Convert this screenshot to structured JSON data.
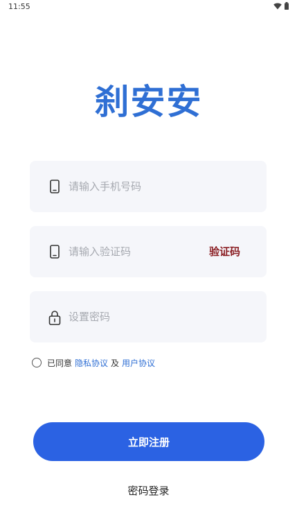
{
  "status_bar": {
    "time": "11:55"
  },
  "logo": {
    "text": "刹安安",
    "color": "#2f6fd4"
  },
  "form": {
    "phone": {
      "placeholder": "请输入手机号码",
      "value": "",
      "icon": "phone-icon"
    },
    "code": {
      "placeholder": "请输入验证码",
      "value": "",
      "icon": "phone-icon",
      "get_code_label": "验证码"
    },
    "password": {
      "placeholder": "设置密码",
      "value": "",
      "icon": "lock-icon"
    }
  },
  "agreement": {
    "prefix": "已同意",
    "privacy_link": "隐私协议",
    "conjunction": "及",
    "user_link": "用户协议",
    "checked": false
  },
  "actions": {
    "register_label": "立即注册",
    "password_login_label": "密码登录"
  },
  "colors": {
    "primary": "#2b62e3",
    "link": "#2f6fd4",
    "get_code": "#8b1f24",
    "field_bg": "#f5f6fa"
  }
}
